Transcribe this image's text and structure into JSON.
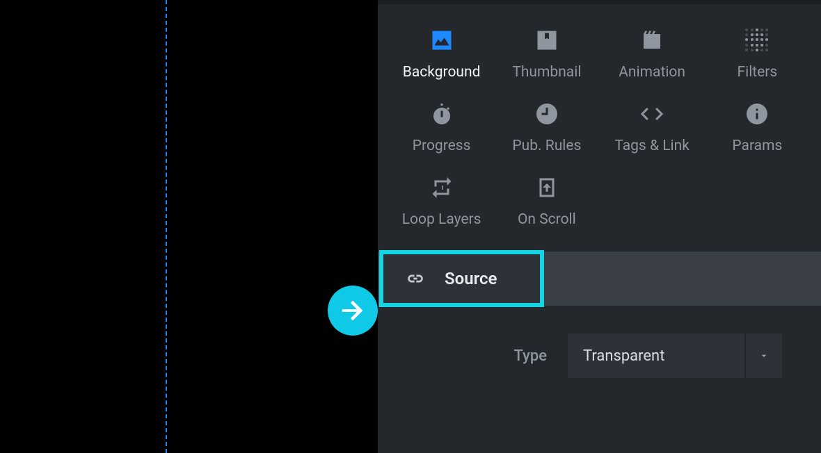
{
  "tabs": {
    "row1": [
      {
        "key": "background",
        "label": "Background",
        "active": true
      },
      {
        "key": "thumbnail",
        "label": "Thumbnail",
        "active": false
      },
      {
        "key": "animation",
        "label": "Animation",
        "active": false
      },
      {
        "key": "filters",
        "label": "Filters",
        "active": false
      }
    ],
    "row2": [
      {
        "key": "progress",
        "label": "Progress",
        "active": false
      },
      {
        "key": "pubrules",
        "label": "Pub. Rules",
        "active": false
      },
      {
        "key": "tagslink",
        "label": "Tags & Link",
        "active": false
      },
      {
        "key": "params",
        "label": "Params",
        "active": false
      }
    ],
    "row3": [
      {
        "key": "looplayers",
        "label": "Loop Layers",
        "active": false
      },
      {
        "key": "onscroll",
        "label": "On Scroll",
        "active": false
      }
    ]
  },
  "section": {
    "title": "Source"
  },
  "type_field": {
    "label": "Type",
    "value": "Transparent"
  }
}
